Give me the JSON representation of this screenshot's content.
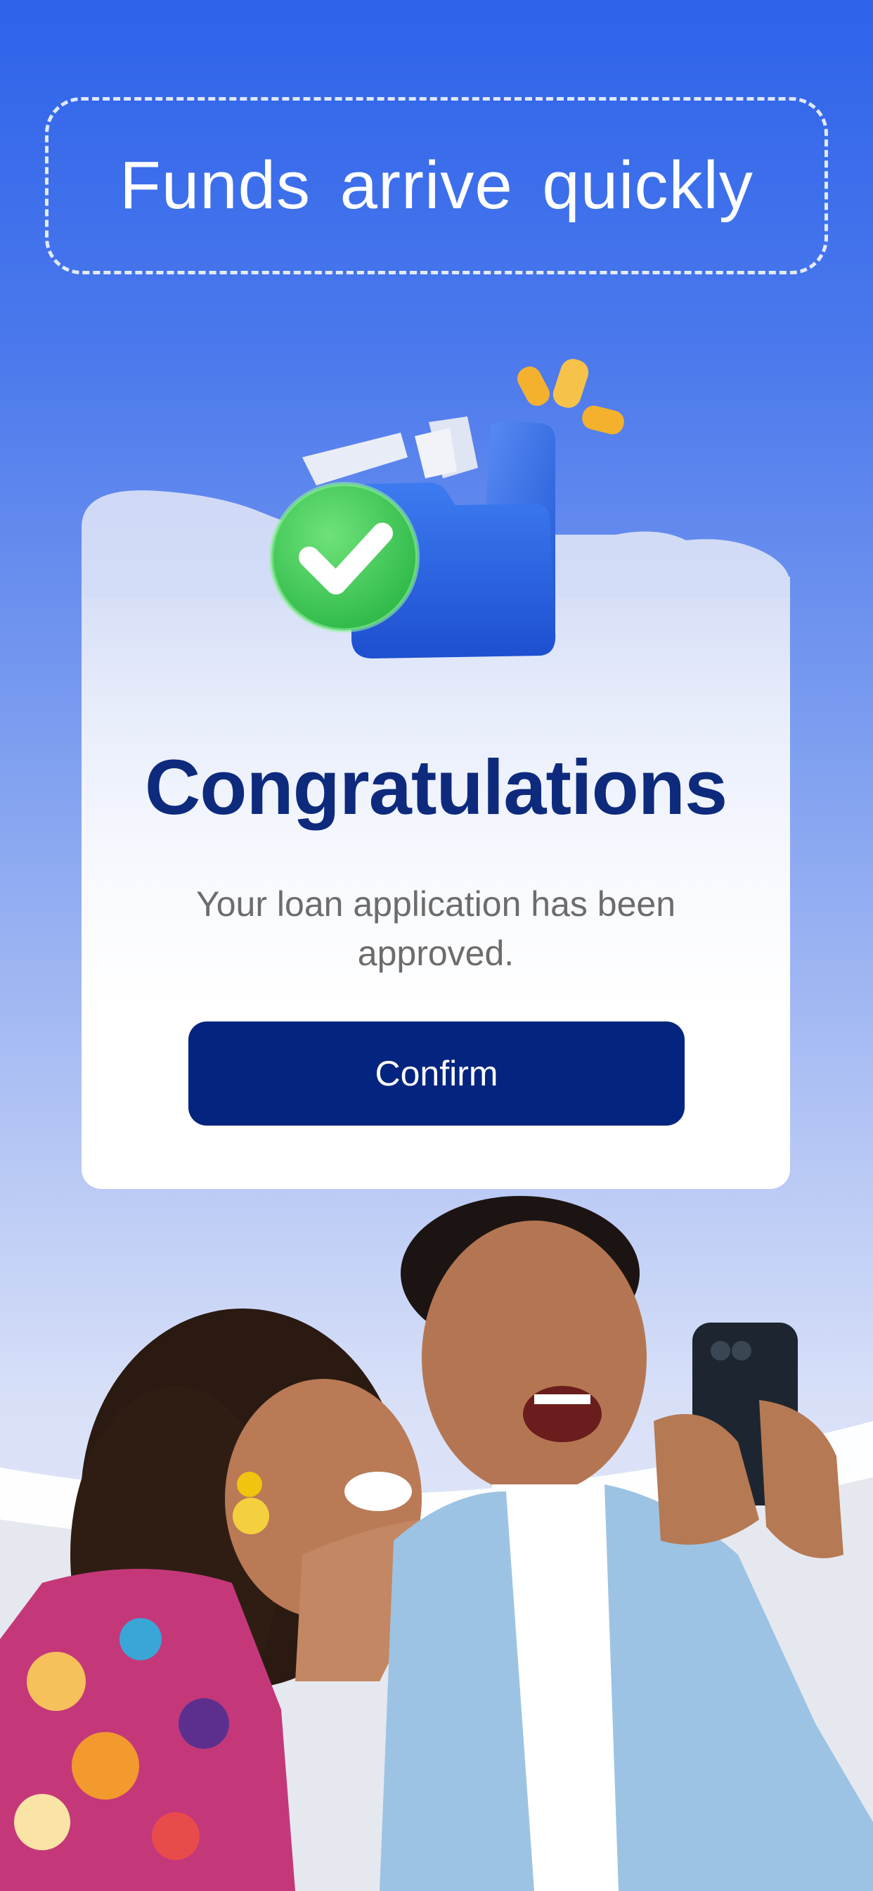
{
  "banner": {
    "title": "Funds arrive quickly"
  },
  "card": {
    "title": "Congratulations",
    "message": "Your loan application has been approved.",
    "confirm_label": "Confirm"
  },
  "illustration": {
    "icon": "folder-approved-icon",
    "check_color": "#3ccf5a",
    "folder_color": "#2f6ee6",
    "spark_color": "#f3b12e"
  },
  "hero": {
    "description_icon": "couple-celebrating-with-phone"
  },
  "colors": {
    "background_top": "#2e63ea",
    "title_color": "#0d2a7d",
    "button_color": "#03247f",
    "accent_orange": "#f58a0f"
  }
}
